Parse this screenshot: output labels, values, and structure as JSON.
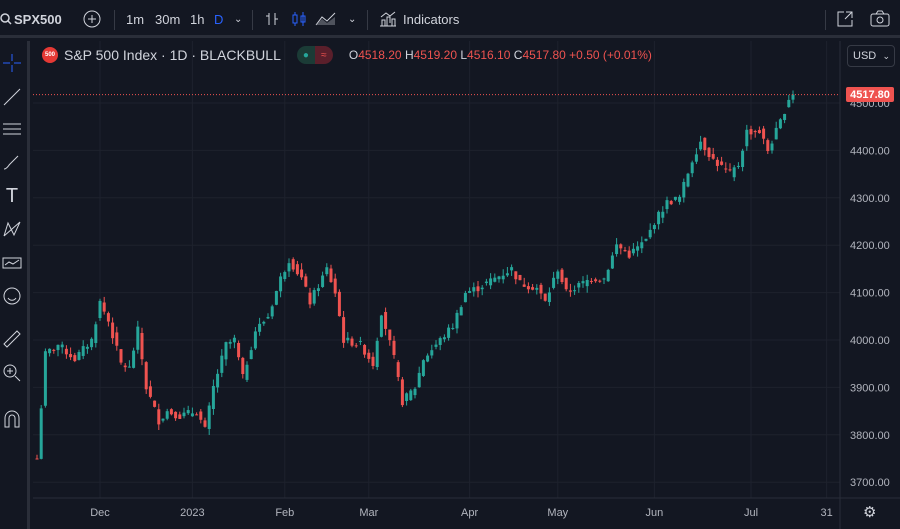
{
  "toolbar": {
    "symbol": "SPX500",
    "intervals": [
      "1m",
      "30m",
      "1h",
      "D"
    ],
    "indicators_label": "Indicators"
  },
  "legend": {
    "title": "S&P 500 Index · 1D · BLACKBULL",
    "badge": "500",
    "open_label": "O",
    "open": "4518.20",
    "high_label": "H",
    "high": "4519.20",
    "low_label": "L",
    "low": "4516.10",
    "close_label": "C",
    "close": "4517.80",
    "change": "+0.50 (+0.01%)"
  },
  "currency": "USD",
  "last_price_label": "4517.80",
  "colors": {
    "up": "#26a69a",
    "down": "#ef5350",
    "background": "#131722",
    "grid": "#1e222d"
  },
  "chart_data": {
    "type": "candlestick",
    "title": "S&P 500 Index · 1D · BLACKBULL",
    "ylim": [
      3660,
      4560
    ],
    "y_ticks": [
      4500,
      4400,
      4300,
      4200,
      4100,
      4000,
      3900,
      3800,
      3700
    ],
    "y_tick_labels": [
      "4500.00",
      "4400.00",
      "4300.00",
      "4200.00",
      "4100.00",
      "4000.00",
      "3900.00",
      "3800.00",
      "3700.00"
    ],
    "x_ticks": [
      {
        "label": "Dec",
        "day": 15
      },
      {
        "label": "2023",
        "day": 37
      },
      {
        "label": "Feb",
        "day": 59
      },
      {
        "label": "Mar",
        "day": 79
      },
      {
        "label": "Apr",
        "day": 103
      },
      {
        "label": "May",
        "day": 124
      },
      {
        "label": "Jun",
        "day": 147
      },
      {
        "label": "Jul",
        "day": 170
      },
      {
        "label": "31",
        "day": 188
      }
    ],
    "num_days": 181,
    "close_path": [
      [
        0,
        3750
      ],
      [
        2,
        3970
      ],
      [
        5,
        3990
      ],
      [
        9,
        3960
      ],
      [
        13,
        4000
      ],
      [
        15,
        4080
      ],
      [
        17,
        4040
      ],
      [
        20,
        3950
      ],
      [
        22,
        3940
      ],
      [
        24,
        4020
      ],
      [
        26,
        3900
      ],
      [
        29,
        3830
      ],
      [
        31,
        3850
      ],
      [
        34,
        3840
      ],
      [
        38,
        3850
      ],
      [
        40,
        3810
      ],
      [
        42,
        3900
      ],
      [
        45,
        3990
      ],
      [
        47,
        4000
      ],
      [
        49,
        3920
      ],
      [
        52,
        4020
      ],
      [
        55,
        4050
      ],
      [
        58,
        4130
      ],
      [
        60,
        4170
      ],
      [
        63,
        4130
      ],
      [
        65,
        4080
      ],
      [
        69,
        4150
      ],
      [
        71,
        4100
      ],
      [
        73,
        4000
      ],
      [
        77,
        3990
      ],
      [
        80,
        3950
      ],
      [
        82,
        4060
      ],
      [
        85,
        3960
      ],
      [
        87,
        3870
      ],
      [
        90,
        3900
      ],
      [
        92,
        3960
      ],
      [
        96,
        4000
      ],
      [
        99,
        4030
      ],
      [
        102,
        4100
      ],
      [
        105,
        4110
      ],
      [
        109,
        4130
      ],
      [
        113,
        4150
      ],
      [
        115,
        4120
      ],
      [
        119,
        4110
      ],
      [
        121,
        4080
      ],
      [
        124,
        4150
      ],
      [
        126,
        4100
      ],
      [
        128,
        4110
      ],
      [
        132,
        4130
      ],
      [
        135,
        4130
      ],
      [
        138,
        4200
      ],
      [
        141,
        4180
      ],
      [
        145,
        4210
      ],
      [
        147,
        4250
      ],
      [
        150,
        4290
      ],
      [
        153,
        4300
      ],
      [
        156,
        4380
      ],
      [
        158,
        4420
      ],
      [
        161,
        4380
      ],
      [
        165,
        4350
      ],
      [
        167,
        4370
      ],
      [
        169,
        4440
      ],
      [
        172,
        4440
      ],
      [
        174,
        4400
      ],
      [
        177,
        4460
      ],
      [
        179,
        4510
      ],
      [
        180,
        4517.8
      ]
    ]
  }
}
